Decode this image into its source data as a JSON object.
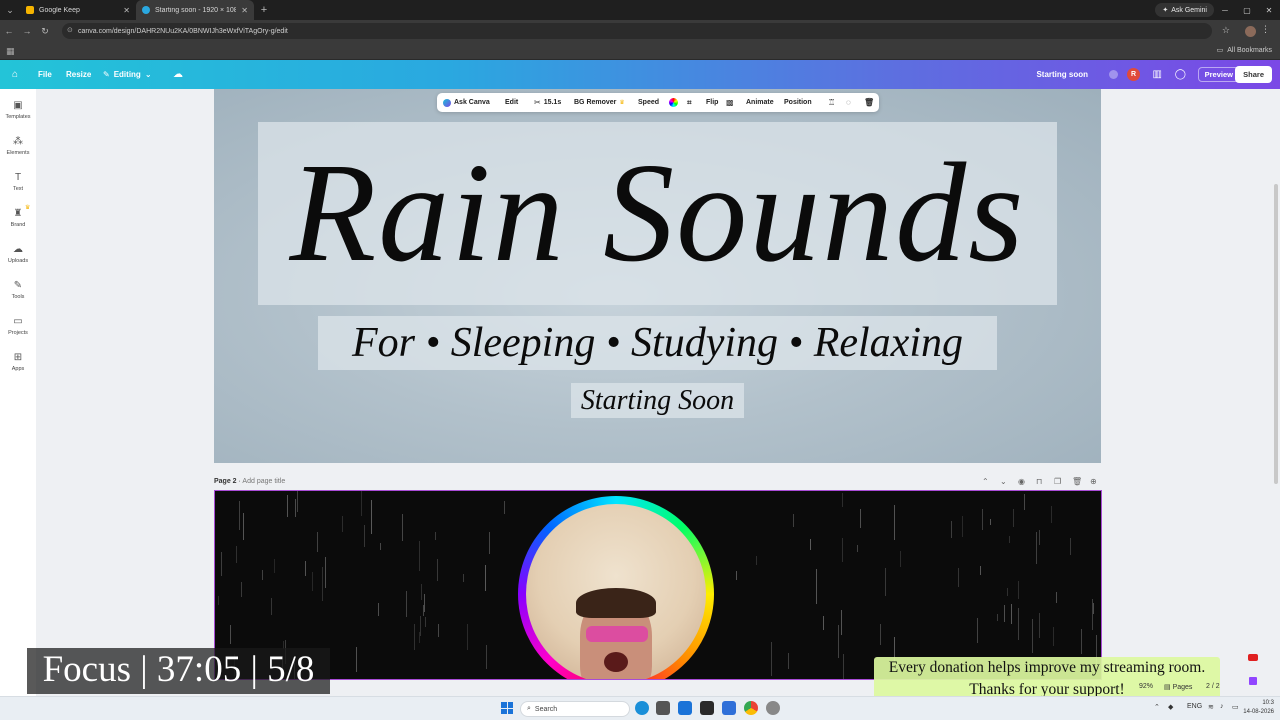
{
  "browser": {
    "tabs": [
      {
        "title": "Google Keep",
        "active": false,
        "favicon_color": "#f6b400"
      },
      {
        "title": "Starting soon - 1920 × 1080px",
        "active": true,
        "favicon_color": "#2aa8e0"
      }
    ],
    "ask_gemini": "Ask Gemini",
    "url": "canva.com/design/DAHR2NUu2KA/0BNWIJh3eWxfViTAgOry-g/edit",
    "all_bookmarks": "All Bookmarks"
  },
  "canva_header": {
    "file": "File",
    "resize": "Resize",
    "editing": "Editing",
    "design_name": "Starting soon",
    "avatar_initial": "R",
    "preview": "Preview",
    "share": "Share"
  },
  "sidebar": {
    "items": [
      {
        "label": "Templates",
        "icon": "templates-icon"
      },
      {
        "label": "Elements",
        "icon": "elements-icon"
      },
      {
        "label": "Text",
        "icon": "text-icon"
      },
      {
        "label": "Brand",
        "icon": "brand-icon"
      },
      {
        "label": "Uploads",
        "icon": "uploads-icon"
      },
      {
        "label": "Tools",
        "icon": "tools-icon"
      },
      {
        "label": "Projects",
        "icon": "projects-icon"
      },
      {
        "label": "Apps",
        "icon": "apps-icon"
      }
    ]
  },
  "toolbar": {
    "ask_canva": "Ask Canva",
    "edit": "Edit",
    "duration": "15.1s",
    "bg_remover": "BG Remover",
    "speed": "Speed",
    "flip": "Flip",
    "animate": "Animate",
    "position": "Position"
  },
  "page1": {
    "title": "Rain Sounds",
    "subtitle": "For • Sleeping • Studying • Relaxing",
    "starting_soon": "Starting Soon"
  },
  "page2": {
    "label": "Page 2",
    "add_title": "Add page title"
  },
  "overlays": {
    "focus": "Focus | 37:05 | 5/8",
    "donation_line1": "Every donation helps improve my streaming room.",
    "donation_line2": "Thanks for your support!"
  },
  "footer": {
    "zoom": "92%",
    "pages": "Pages",
    "pages_count": "2 / 2"
  },
  "taskbar": {
    "search": "Search",
    "lang": "ENG",
    "time": "10:3",
    "date": "14-08-2026"
  }
}
